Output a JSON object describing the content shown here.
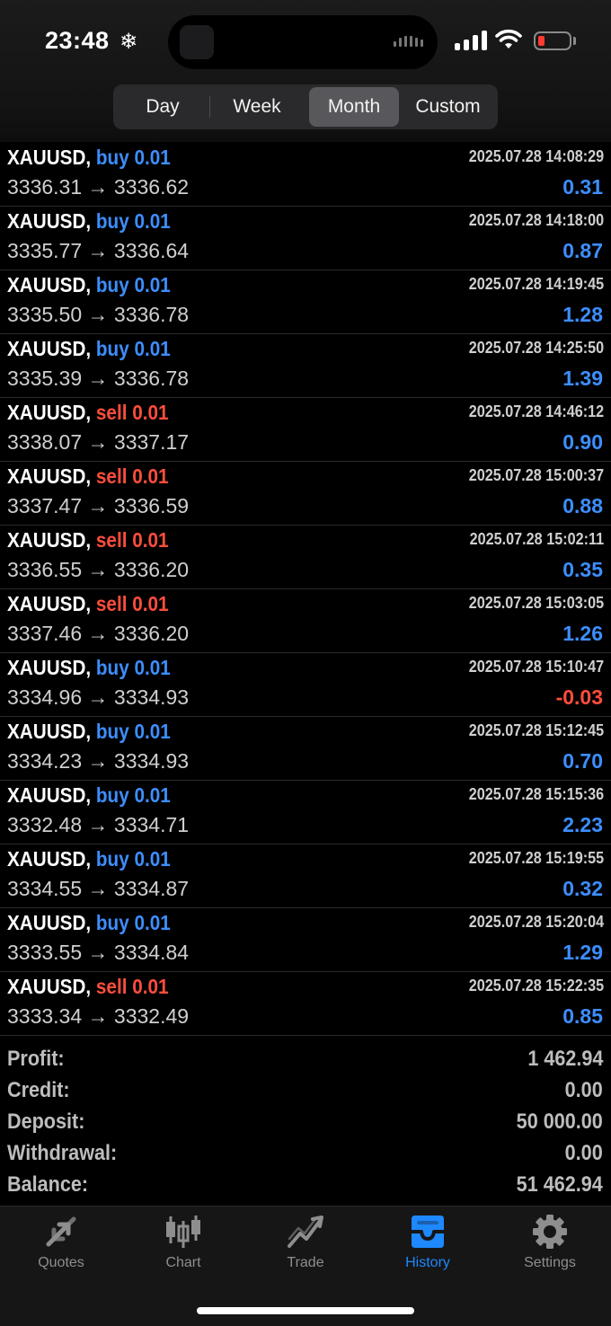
{
  "status_bar": {
    "time": "23:48",
    "weather_icon": "snowflake-icon",
    "battery_color": "#ff3b30"
  },
  "period_tabs": [
    {
      "label": "Day",
      "active": false
    },
    {
      "label": "Week",
      "active": false
    },
    {
      "label": "Month",
      "active": true
    },
    {
      "label": "Custom",
      "active": false
    }
  ],
  "colors": {
    "buy": "#3d8eff",
    "sell": "#ff4d3d",
    "accent": "#1e88ff",
    "background": "#000000"
  },
  "deals": [
    {
      "symbol": "XAUUSD,",
      "side": "buy 0.01",
      "type": "buy",
      "time": "2025.07.28 14:08:29",
      "prices": "3336.31 → 3336.62",
      "profit": "0.31"
    },
    {
      "symbol": "XAUUSD,",
      "side": "buy 0.01",
      "type": "buy",
      "time": "2025.07.28 14:18:00",
      "prices": "3335.77 → 3336.64",
      "profit": "0.87"
    },
    {
      "symbol": "XAUUSD,",
      "side": "buy 0.01",
      "type": "buy",
      "time": "2025.07.28 14:19:45",
      "prices": "3335.50 → 3336.78",
      "profit": "1.28"
    },
    {
      "symbol": "XAUUSD,",
      "side": "buy 0.01",
      "type": "buy",
      "time": "2025.07.28 14:25:50",
      "prices": "3335.39 → 3336.78",
      "profit": "1.39"
    },
    {
      "symbol": "XAUUSD,",
      "side": "sell 0.01",
      "type": "sell",
      "time": "2025.07.28 14:46:12",
      "prices": "3338.07 → 3337.17",
      "profit": "0.90"
    },
    {
      "symbol": "XAUUSD,",
      "side": "sell 0.01",
      "type": "sell",
      "time": "2025.07.28 15:00:37",
      "prices": "3337.47 → 3336.59",
      "profit": "0.88"
    },
    {
      "symbol": "XAUUSD,",
      "side": "sell 0.01",
      "type": "sell",
      "time": "2025.07.28 15:02:11",
      "prices": "3336.55 → 3336.20",
      "profit": "0.35"
    },
    {
      "symbol": "XAUUSD,",
      "side": "sell 0.01",
      "type": "sell",
      "time": "2025.07.28 15:03:05",
      "prices": "3337.46 → 3336.20",
      "profit": "1.26"
    },
    {
      "symbol": "XAUUSD,",
      "side": "buy 0.01",
      "type": "buy",
      "time": "2025.07.28 15:10:47",
      "prices": "3334.96 → 3334.93",
      "profit": "-0.03"
    },
    {
      "symbol": "XAUUSD,",
      "side": "buy 0.01",
      "type": "buy",
      "time": "2025.07.28 15:12:45",
      "prices": "3334.23 → 3334.93",
      "profit": "0.70"
    },
    {
      "symbol": "XAUUSD,",
      "side": "buy 0.01",
      "type": "buy",
      "time": "2025.07.28 15:15:36",
      "prices": "3332.48 → 3334.71",
      "profit": "2.23"
    },
    {
      "symbol": "XAUUSD,",
      "side": "buy 0.01",
      "type": "buy",
      "time": "2025.07.28 15:19:55",
      "prices": "3334.55 → 3334.87",
      "profit": "0.32"
    },
    {
      "symbol": "XAUUSD,",
      "side": "buy 0.01",
      "type": "buy",
      "time": "2025.07.28 15:20:04",
      "prices": "3333.55 → 3334.84",
      "profit": "1.29"
    },
    {
      "symbol": "XAUUSD,",
      "side": "sell 0.01",
      "type": "sell",
      "time": "2025.07.28 15:22:35",
      "prices": "3333.34 → 3332.49",
      "profit": "0.85"
    }
  ],
  "summary": {
    "profit_label": "Profit:",
    "profit_value": "1 462.94",
    "credit_label": "Credit:",
    "credit_value": "0.00",
    "deposit_label": "Deposit:",
    "deposit_value": "50 000.00",
    "withdrawal_label": "Withdrawal:",
    "withdrawal_value": "0.00",
    "balance_label": "Balance:",
    "balance_value": "51 462.94"
  },
  "tab_bar": [
    {
      "label": "Quotes",
      "icon": "quotes-arrows-icon",
      "active": false
    },
    {
      "label": "Chart",
      "icon": "candlestick-chart-icon",
      "active": false
    },
    {
      "label": "Trade",
      "icon": "trade-trend-icon",
      "active": false
    },
    {
      "label": "History",
      "icon": "history-inbox-icon",
      "active": true
    },
    {
      "label": "Settings",
      "icon": "gear-icon",
      "active": false
    }
  ]
}
